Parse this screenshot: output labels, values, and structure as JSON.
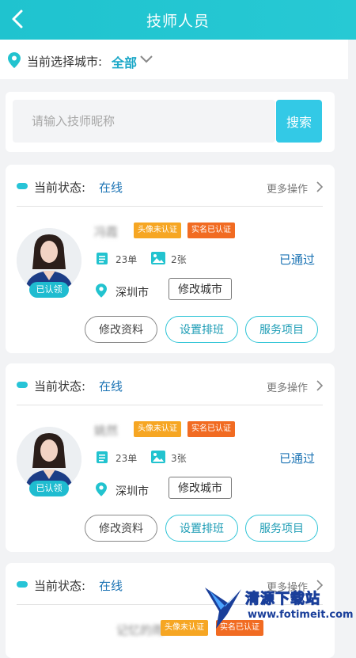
{
  "header": {
    "title": "技师人员"
  },
  "city_bar": {
    "label": "当前选择城市:",
    "value": "全部"
  },
  "search": {
    "placeholder": "请输入技师昵称",
    "button": "搜索"
  },
  "colors": {
    "accent": "#27c9d4",
    "status_blue": "#1b73b4",
    "tag_orange": "#f6a623",
    "tag_red": "#f16b22"
  },
  "technicians": [
    {
      "status_label": "当前状态:",
      "status_value": "在线",
      "more_ops": "更多操作",
      "name": "冯霞",
      "tag_avatar": "头像未认证",
      "tag_realname": "实名已认证",
      "orders": "23单",
      "photos": "2张",
      "approval": "已通过",
      "badge": "已认领",
      "city": "深圳市",
      "edit_city": "修改城市",
      "actions": [
        "修改资料",
        "设置排班",
        "服务项目"
      ]
    },
    {
      "status_label": "当前状态:",
      "status_value": "在线",
      "more_ops": "更多操作",
      "name": "姚然",
      "tag_avatar": "头像未认证",
      "tag_realname": "实名已认证",
      "orders": "23单",
      "photos": "3张",
      "approval": "已通过",
      "badge": "已认领",
      "city": "深圳市",
      "edit_city": "修改城市",
      "actions": [
        "修改资料",
        "设置排班",
        "服务项目"
      ]
    },
    {
      "status_label": "当前状态:",
      "status_value": "在线",
      "more_ops": "更多操作",
      "name": "记忆的雨",
      "tag_avatar": "头像未认证",
      "tag_realname": "实名已认证"
    }
  ],
  "watermark": {
    "brand": "清源下载站",
    "url": "www.fotimeit.com"
  }
}
